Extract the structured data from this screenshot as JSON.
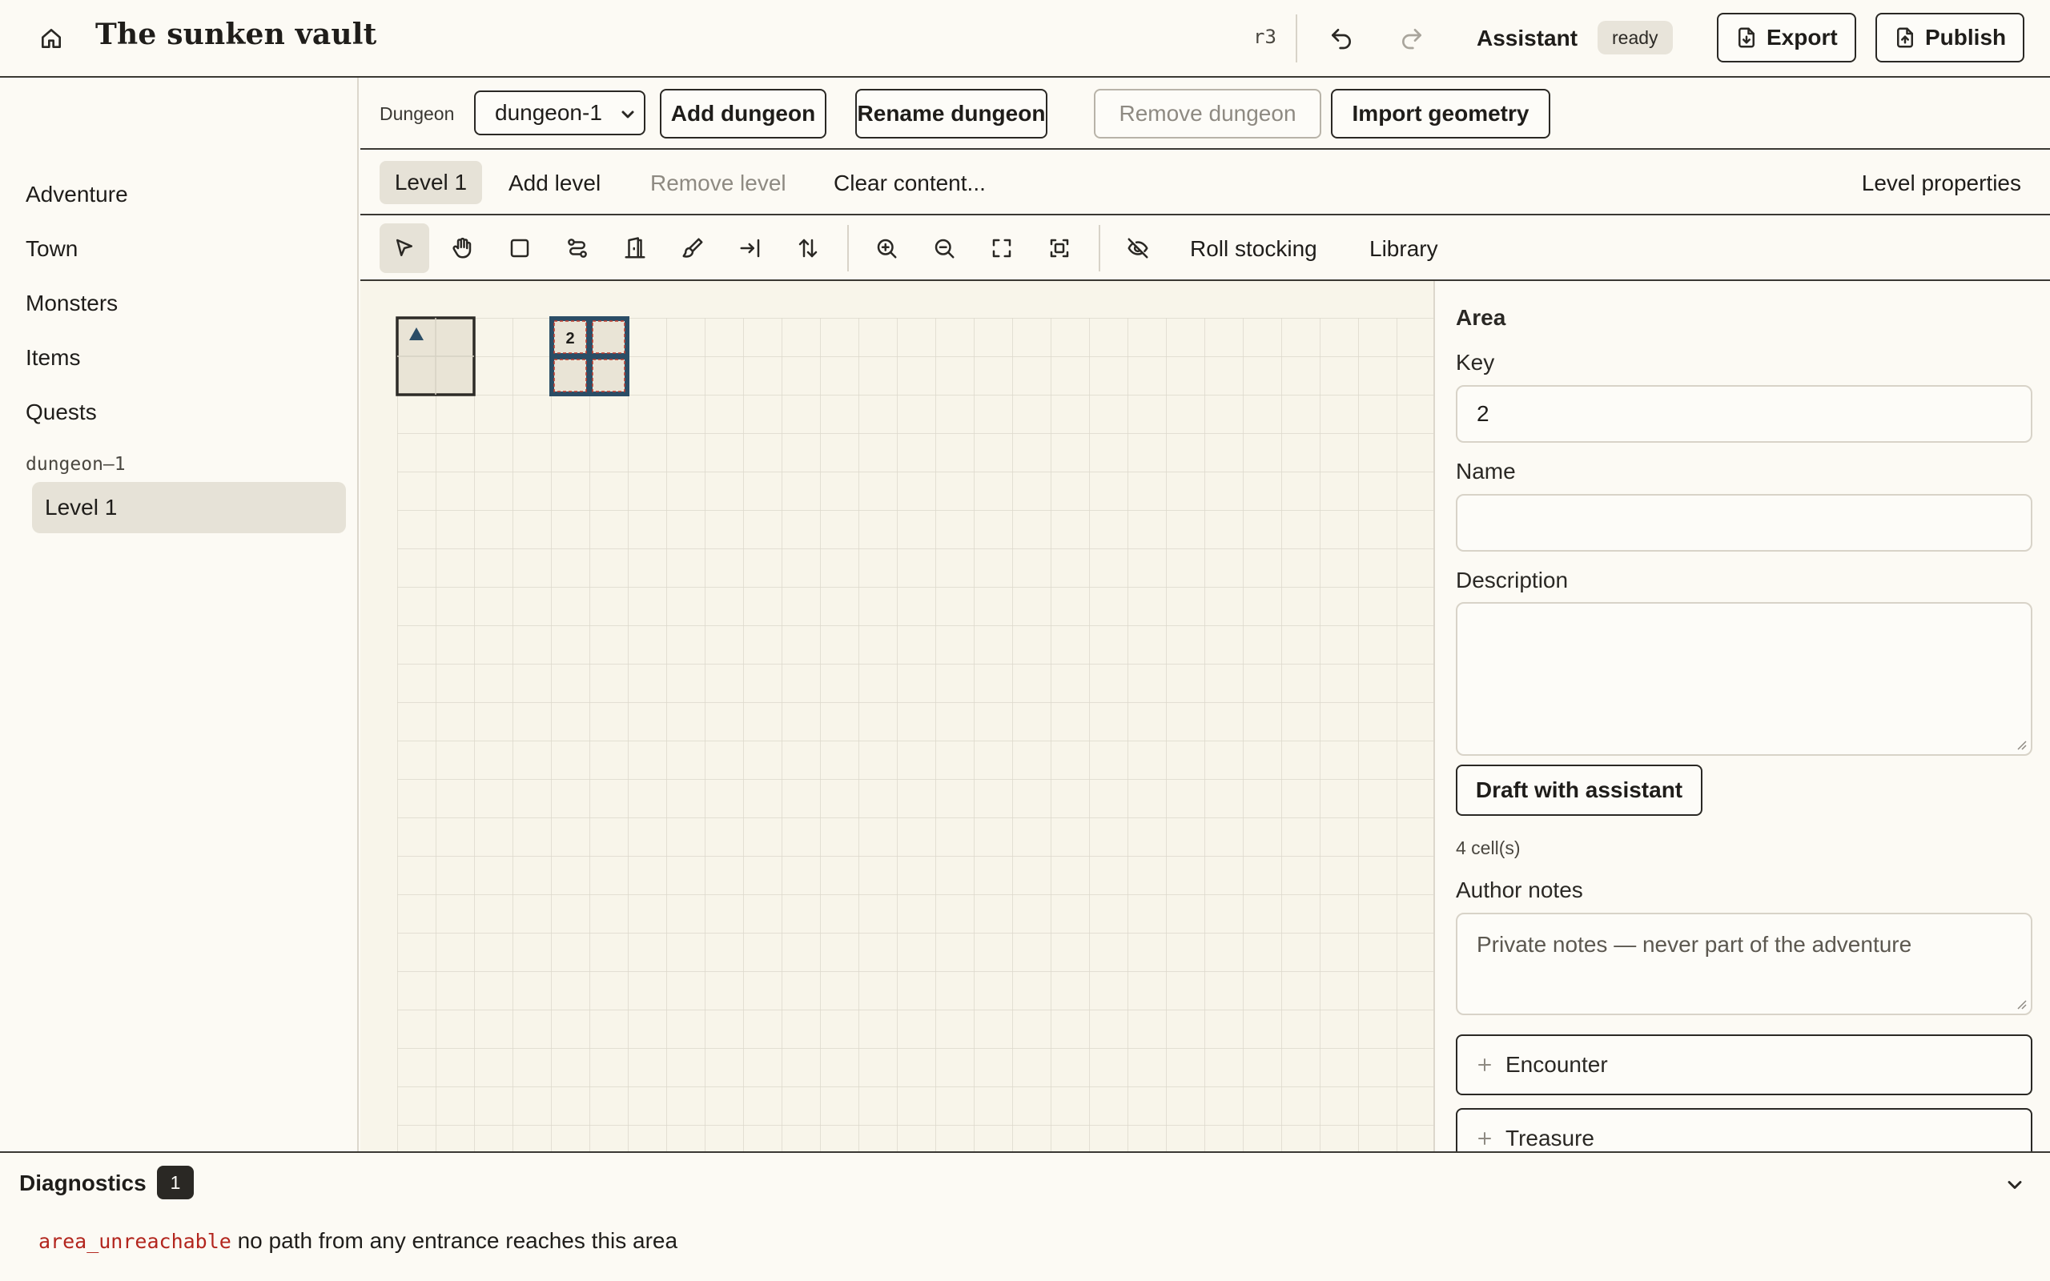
{
  "header": {
    "title": "The sunken vault",
    "revision": "r3",
    "assistant_label": "Assistant",
    "assistant_status": "ready",
    "export_label": "Export",
    "publish_label": "Publish",
    "icons": {
      "home": "home-icon",
      "undo": "undo-icon",
      "redo": "redo-icon",
      "export": "file-download-icon",
      "publish": "file-upload-icon"
    }
  },
  "sidebar": {
    "items": [
      {
        "label": "Adventure"
      },
      {
        "label": "Town"
      },
      {
        "label": "Monsters"
      },
      {
        "label": "Items"
      },
      {
        "label": "Quests"
      }
    ],
    "group_label": "dungeon–1",
    "active_level": "Level 1"
  },
  "dungeon_bar": {
    "label": "Dungeon",
    "selected": "dungeon-1",
    "add_label": "Add dungeon",
    "rename_label": "Rename dungeon",
    "remove_label": "Remove dungeon",
    "import_label": "Import geometry"
  },
  "level_bar": {
    "active_tab": "Level 1",
    "add_label": "Add level",
    "remove_label": "Remove level",
    "clear_label": "Clear content...",
    "properties_label": "Level properties"
  },
  "toolbar": {
    "tools": [
      "select-icon",
      "pan-icon",
      "rectangle-icon",
      "corridor-icon",
      "door-icon",
      "paint-icon",
      "entrance-icon",
      "stairs-icon"
    ],
    "view_tools": [
      "zoom-in-icon",
      "zoom-out-icon",
      "fit-view-icon",
      "focus-selection-icon"
    ],
    "visibility_tool": "eye-off-icon",
    "roll_stocking_label": "Roll stocking",
    "library_label": "Library"
  },
  "canvas": {
    "area_key": "2",
    "colors": {
      "grid": "#dcd8cb",
      "room_fill": "#e9e4d6",
      "room_border": "#2d2b27",
      "selected_border": "#2b4d66",
      "dashed": "#c0392b",
      "entrance": "#2b4d66"
    }
  },
  "inspector": {
    "title": "Area",
    "key_label": "Key",
    "key_value": "2",
    "name_label": "Name",
    "name_value": "",
    "description_label": "Description",
    "description_value": "",
    "draft_label": "Draft with assistant",
    "cell_count": "4 cell(s)",
    "notes_label": "Author notes",
    "notes_placeholder": "Private notes — never part of the adventure",
    "encounter_label": "Encounter",
    "treasure_label": "Treasure"
  },
  "diagnostics": {
    "title": "Diagnostics",
    "count": "1",
    "items": [
      {
        "code": "area_unreachable",
        "message": "no path from any entrance reaches this area"
      }
    ]
  }
}
